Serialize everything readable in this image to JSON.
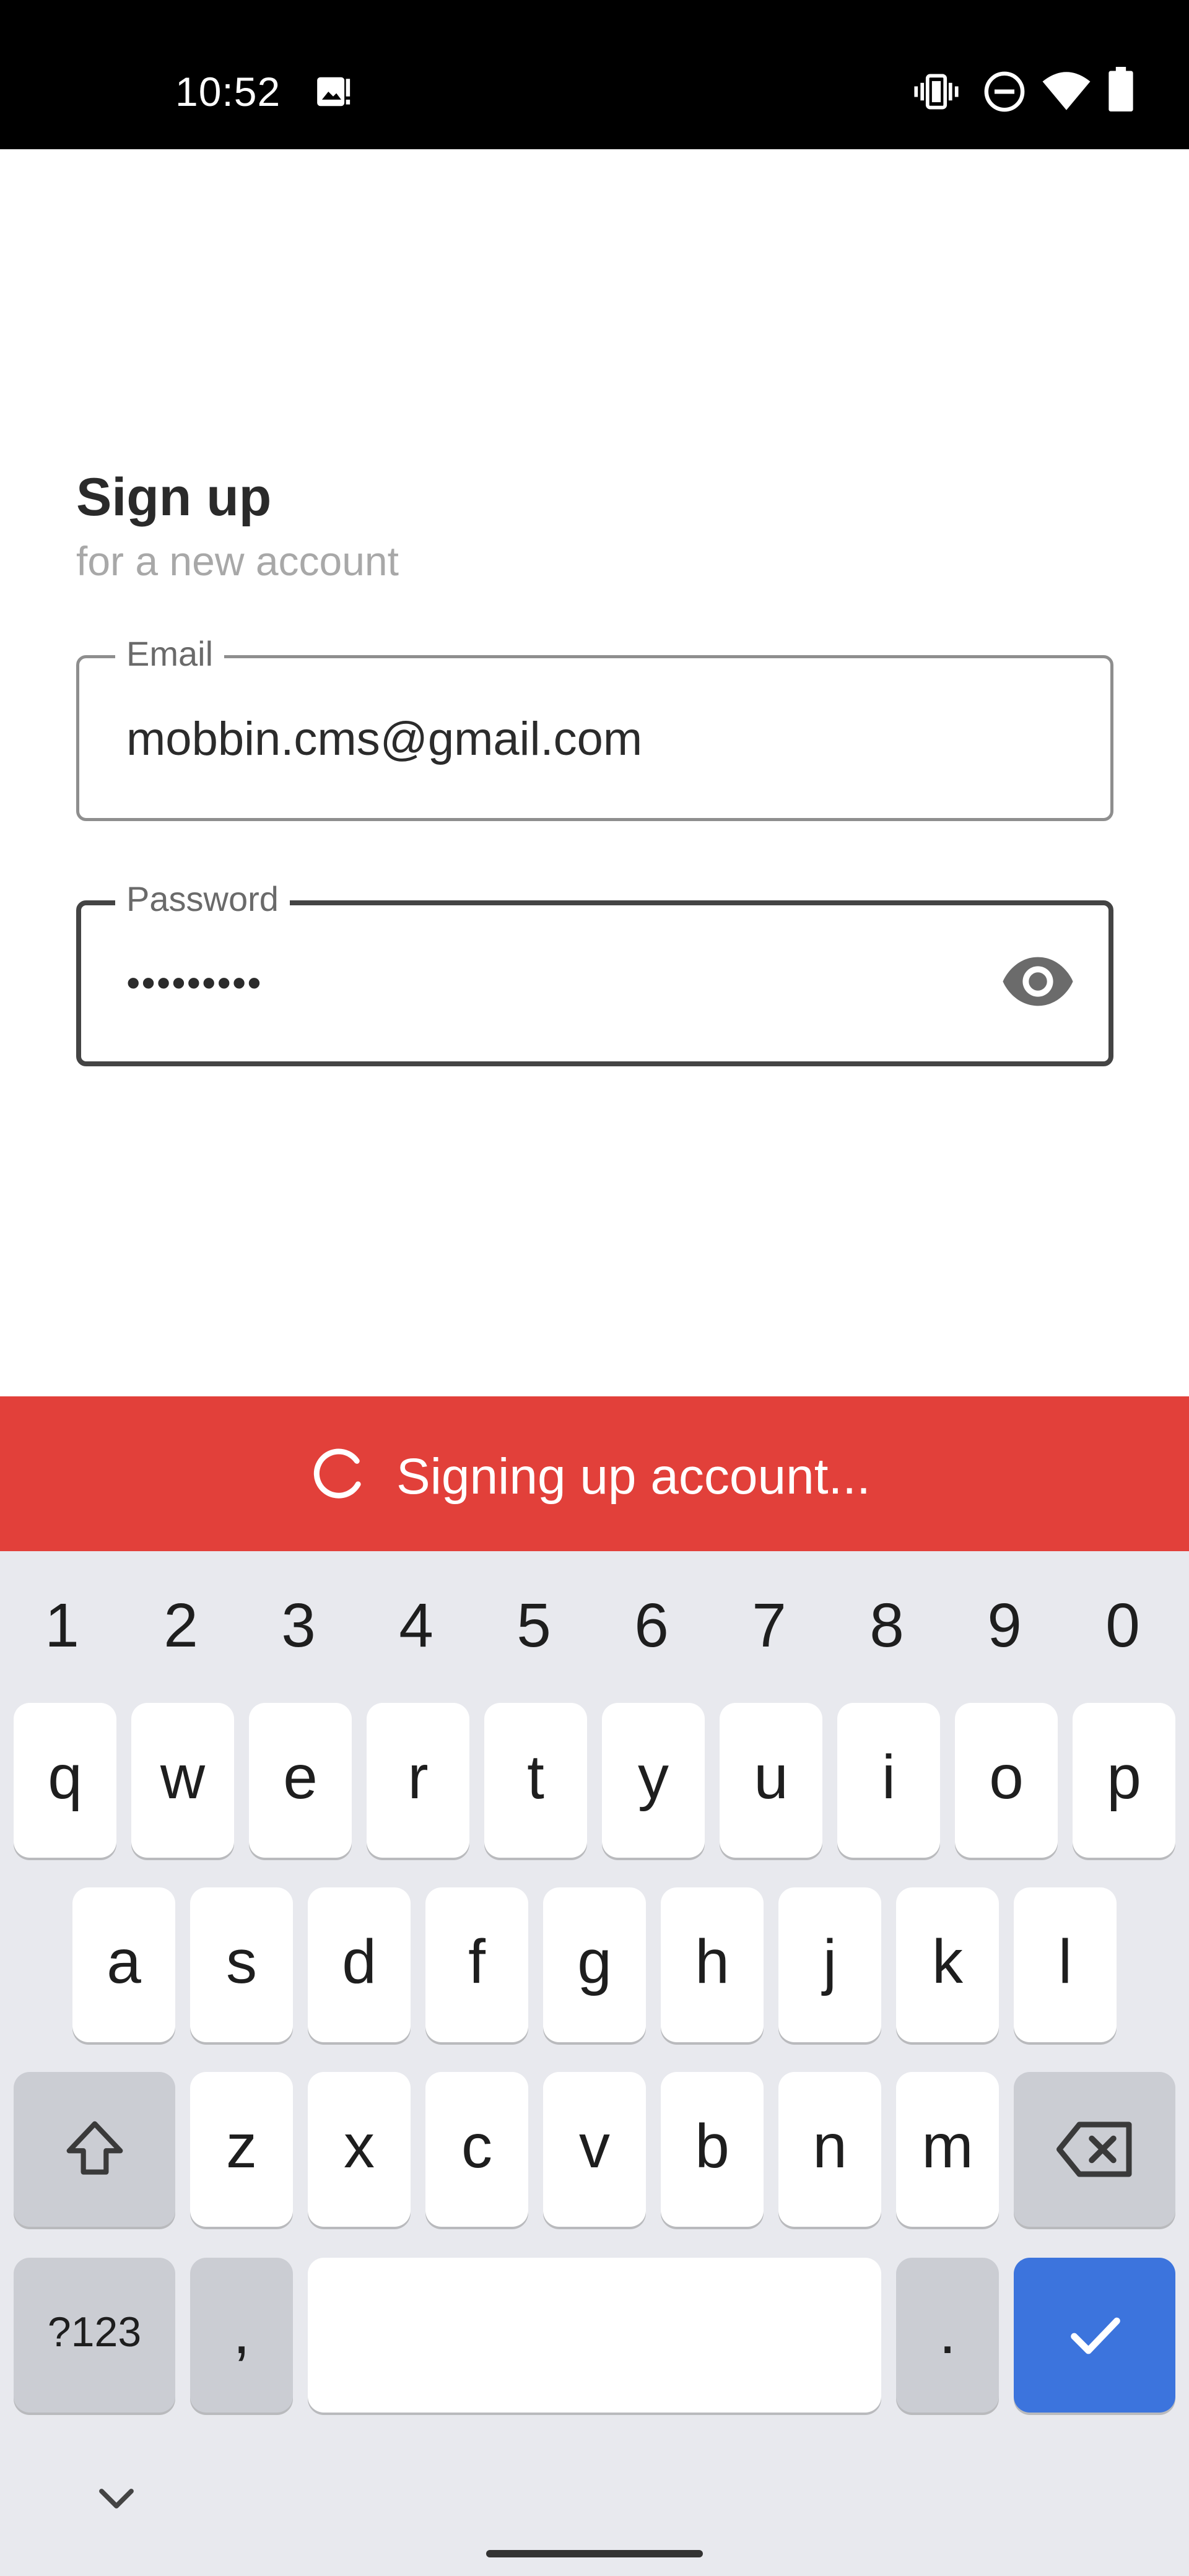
{
  "status_bar": {
    "time": "10:52",
    "icons": [
      "gallery-icon",
      "vibrate-icon",
      "do-not-disturb-icon",
      "wifi-icon",
      "battery-icon"
    ]
  },
  "form": {
    "title": "Sign up",
    "subtitle": "for a new account",
    "email": {
      "label": "Email",
      "value": "mobbin.cms@gmail.com"
    },
    "password": {
      "label": "Password",
      "value": "•••••••••",
      "toggle_icon": "eye-icon"
    }
  },
  "snackbar": {
    "text": "Signing up account...",
    "icon": "spinner-icon",
    "color": "#e2403a"
  },
  "keyboard": {
    "numbers": [
      "1",
      "2",
      "3",
      "4",
      "5",
      "6",
      "7",
      "8",
      "9",
      "0"
    ],
    "row1": [
      "q",
      "w",
      "e",
      "r",
      "t",
      "y",
      "u",
      "i",
      "o",
      "p"
    ],
    "row2": [
      "a",
      "s",
      "d",
      "f",
      "g",
      "h",
      "j",
      "k",
      "l"
    ],
    "row3": [
      "z",
      "x",
      "c",
      "v",
      "b",
      "n",
      "m"
    ],
    "symbols_label": "?123",
    "comma": ",",
    "period": ".",
    "shift_icon": "shift-icon",
    "backspace_icon": "backspace-icon",
    "enter_icon": "check-icon",
    "hide_icon": "chevron-down-icon",
    "accent_color": "#3c74dd"
  }
}
